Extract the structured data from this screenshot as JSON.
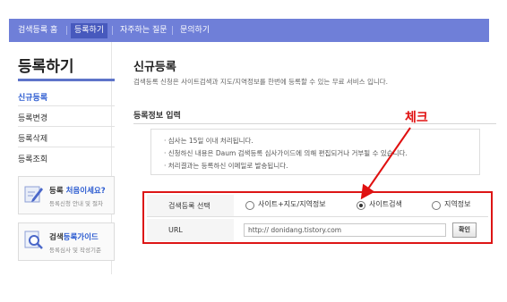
{
  "topnav": {
    "items": [
      "검색등록 홈",
      "등록하기",
      "자주하는 질문",
      "문의하기"
    ],
    "active_index": 1
  },
  "sidebar": {
    "title": "등록하기",
    "items": [
      "신규등록",
      "등록변경",
      "등록삭제",
      "등록조회"
    ],
    "active_index": 0,
    "promos": [
      {
        "title_plain": "등록 ",
        "title_highlight": "처음이세요?",
        "subtitle": "등록신청 안내 및 절차",
        "icon": "pencil-icon"
      },
      {
        "title_plain": "검색",
        "title_highlight": "등록가이드",
        "subtitle": "등록심사 및 작성기준",
        "icon": "magnifier-icon"
      }
    ]
  },
  "main": {
    "title": "신규등록",
    "description": "검색등록 신청은 사이트검색과 지도/지역정보를 한번에 등록할 수 있는 무료 서비스 입니다.",
    "section_title": "등록정보 입력",
    "notice_lines": [
      "· 심사는 15일 이내 처리됩니다.",
      "· 신청하신 내용은 Daum 검색등록 심사가이드에 의해 편집되거나 거부될 수 있습니다.",
      "· 처리결과는 등록하신 이메일로 발송됩니다."
    ]
  },
  "annotation": {
    "text": "체크",
    "color": "#e01010"
  },
  "form": {
    "type_label": "검색등록 선택",
    "options": [
      "사이트+지도/지역정보",
      "사이트검색",
      "지역정보"
    ],
    "selected_index": 1,
    "url_label": "URL",
    "url_value": "http:// donidang.tistory.com",
    "confirm_label": "확인"
  },
  "colors": {
    "nav_bg": "#6f7fd8",
    "nav_active": "#4759bd",
    "accent": "#2a5ad0",
    "highlight_border": "#dd1515"
  }
}
